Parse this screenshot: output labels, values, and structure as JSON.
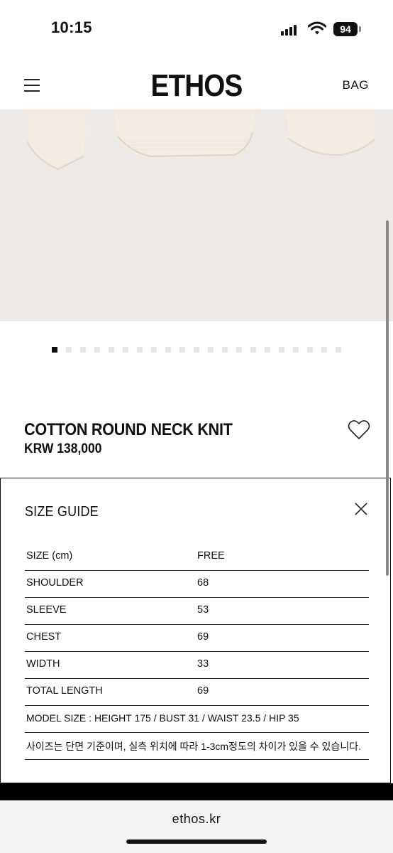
{
  "status_bar": {
    "time": "10:15",
    "battery": "94"
  },
  "header": {
    "brand": "ETHOS",
    "bag_label": "BAG"
  },
  "product": {
    "title": "COTTON ROUND NECK KNIT",
    "price": "KRW 138,000",
    "image_count": 21,
    "active_image": 1
  },
  "size_guide": {
    "title": "SIZE GUIDE",
    "header": {
      "label": "SIZE (cm)",
      "value": "FREE"
    },
    "rows": [
      {
        "label": "SHOULDER",
        "value": "68"
      },
      {
        "label": "SLEEVE",
        "value": "53"
      },
      {
        "label": "CHEST",
        "value": "69"
      },
      {
        "label": "WIDTH",
        "value": "33"
      },
      {
        "label": "TOTAL LENGTH",
        "value": "69"
      }
    ],
    "model_size": "MODEL SIZE : HEIGHT 175 / BUST 31 / WAIST 23.5 / HIP 35",
    "note": "사이즈는 단면 기준이며, 실측 위치에 따라 1-3cm정도의 차이가 있을 수 있습니다."
  },
  "browser": {
    "url": "ethos.kr"
  },
  "icons": [
    "menu-icon",
    "heart-icon",
    "close-icon",
    "signal-icon",
    "wifi-icon",
    "battery-icon"
  ]
}
